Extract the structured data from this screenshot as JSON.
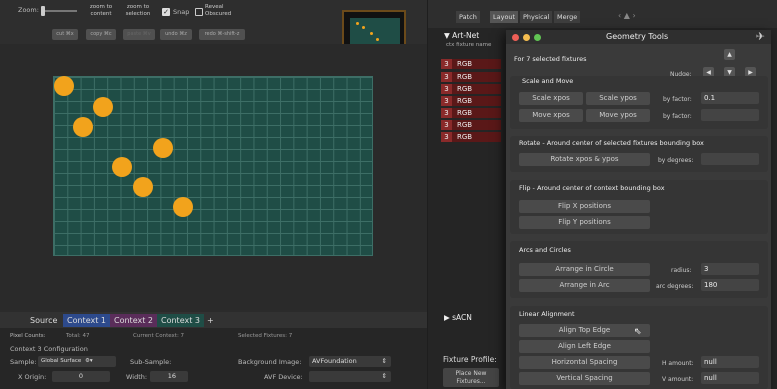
{
  "toolbar": {
    "zoom_label": "Zoom:",
    "zoom_to_content": "zoom to content",
    "zoom_to_selection": "zoom to selection",
    "snap_label": "Snap",
    "reveal_obscured": "Reveal Obscured",
    "cut": "cut ⌘x",
    "copy": "copy ⌘c",
    "paste": "paste ⌘v",
    "undo": "undo ⌘z",
    "redo": "redo ⌘-shift-z"
  },
  "tabs": {
    "source": "Source",
    "context1": "Context 1",
    "context2": "Context 2",
    "context3": "Context 3",
    "add": "+"
  },
  "stats": {
    "pixel_counts": "Pixel Counts:",
    "total": "Total: 47",
    "current_context": "Current Context: 7",
    "selected_fixtures": "Selected Fixtures: 7"
  },
  "config": {
    "title": "Context 3 Configuration",
    "sample_label": "Sample:",
    "sample_value": "Global Surface",
    "subsample_label": "Sub-Sample:",
    "bg_image_label": "Background Image:",
    "bg_image_value": "AVFoundation",
    "x_origin_label": "X Origin:",
    "x_origin_value": "0",
    "width_label": "Width:",
    "width_value": "16",
    "avf_device_label": "AVF Device:"
  },
  "right": {
    "tabs": [
      "Patch",
      "Layout",
      "Physical",
      "Merge"
    ],
    "artnet": "▼ Art-Net",
    "columns": "ctx  fixture name",
    "rows": [
      {
        "num": "3",
        "name": "RGB"
      },
      {
        "num": "3",
        "name": "RGB"
      },
      {
        "num": "3",
        "name": "RGB"
      },
      {
        "num": "3",
        "name": "RGB"
      },
      {
        "num": "3",
        "name": "RGB"
      },
      {
        "num": "3",
        "name": "RGB"
      },
      {
        "num": "3",
        "name": "RGB"
      }
    ],
    "sacn": "▶ sACN",
    "fixture_profile": "Fixture Profile:",
    "place_new": "Place New Fixtures..."
  },
  "dialog": {
    "title": "Geometry Tools",
    "subtitle": "For 7 selected fixtures",
    "nudge": "Nudge:",
    "scale_move": "Scale and Move",
    "scale_x": "Scale xpos",
    "scale_y": "Scale ypos",
    "by_factor": "by factor:",
    "factor_value": "0.1",
    "move_x": "Move xpos",
    "move_y": "Move ypos",
    "by_factor2": "by factor:",
    "rotate_title": "Rotate - Around center of selected fixtures bounding box",
    "rotate_btn": "Rotate xpos & ypos",
    "by_degrees": "by degrees:",
    "flip_title": "Flip - Around center of context bounding box",
    "flip_x": "Flip X positions",
    "flip_y": "Flip Y positions",
    "arcs_title": "Arcs and Circles",
    "arrange_circle": "Arrange in Circle",
    "radius_label": "radius:",
    "radius_value": "3",
    "arrange_arc": "Arrange in Arc",
    "arc_degrees_label": "arc degrees:",
    "arc_degrees_value": "180",
    "linear_title": "Linear Alignment",
    "align_top": "Align Top Edge",
    "align_left": "Align Left Edge",
    "h_spacing": "Horizontal Spacing",
    "h_amount_label": "H amount:",
    "h_amount_value": "null",
    "v_spacing": "Vertical Spacing",
    "v_amount_label": "V amount:",
    "v_amount_value": "null"
  },
  "colors": {
    "accent_orange": "#f2a31c",
    "grid_teal": "#1f4d46",
    "fixture_red": "#5a1818"
  }
}
